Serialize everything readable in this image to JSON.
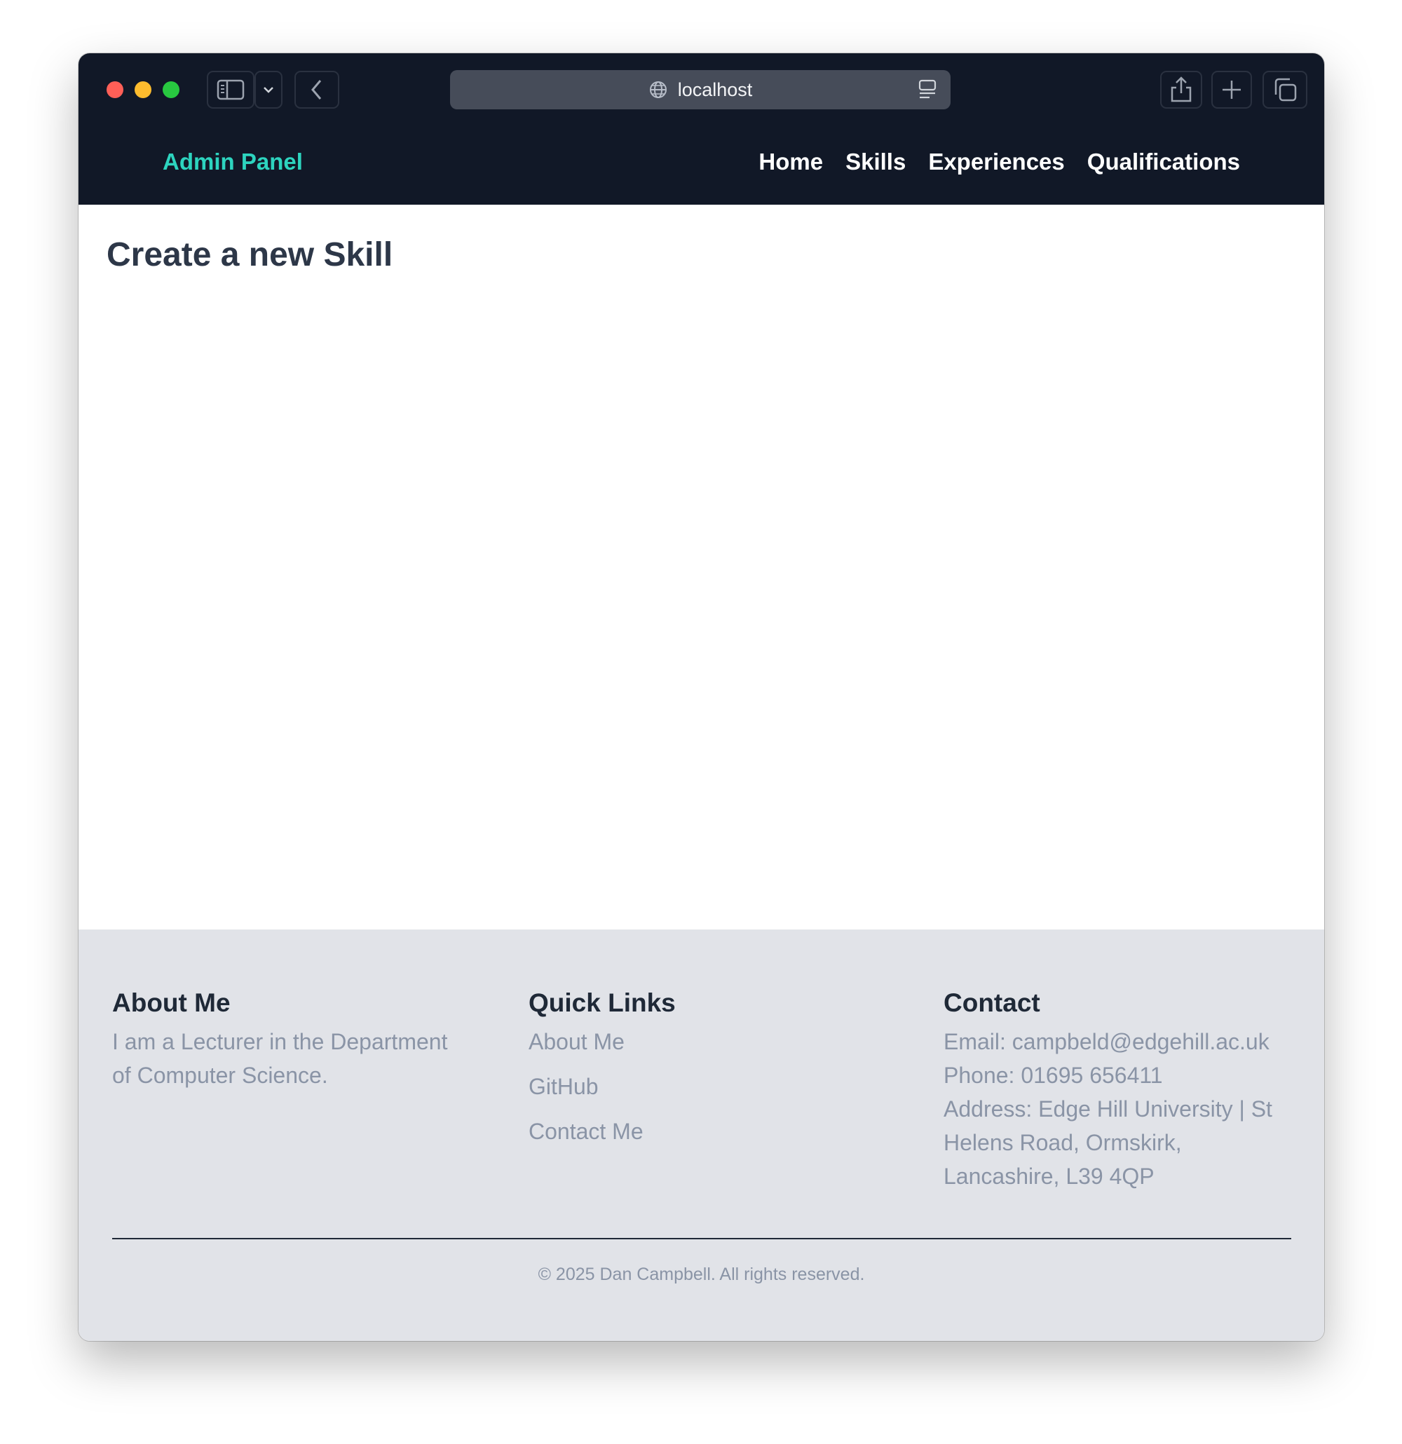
{
  "browser": {
    "url": "localhost",
    "icons": {
      "close": "close-dot",
      "minimize": "minimize-dot",
      "zoom": "zoom-dot",
      "sidebar": "sidebar-icon",
      "chevron": "chevron-down-icon",
      "back": "back-arrow-icon",
      "site": "globe-icon",
      "reader": "reader-icon",
      "share": "share-icon",
      "new_tab": "plus-icon",
      "tabs": "tabs-overview-icon"
    },
    "colors": {
      "close": "#ff5f57",
      "minimize": "#febc2e",
      "zoom": "#28c840",
      "chrome": "#111827"
    }
  },
  "nav": {
    "brand": "Admin Panel",
    "links": [
      "Home",
      "Skills",
      "Experiences",
      "Qualifications"
    ],
    "colors": {
      "brand": "#2dd4bf",
      "background": "#111827"
    }
  },
  "main": {
    "title": "Create a new Skill"
  },
  "footer": {
    "about": {
      "heading": "About Me",
      "text": "I am a Lecturer in the Department of Computer Science."
    },
    "quick_links": {
      "heading": "Quick Links",
      "links": [
        "About Me",
        "GitHub",
        "Contact Me"
      ]
    },
    "contact": {
      "heading": "Contact",
      "email": "Email: campbeld@edgehill.ac.uk",
      "phone": "Phone: 01695 656411",
      "address": "Address: Edge Hill University | St Helens Road, Ormskirk, Lancashire, L39 4QP"
    },
    "copyright": "© 2025 Dan Campbell. All rights reserved.",
    "colors": {
      "background": "#e1e3e8",
      "text": "#8a94a6"
    }
  }
}
